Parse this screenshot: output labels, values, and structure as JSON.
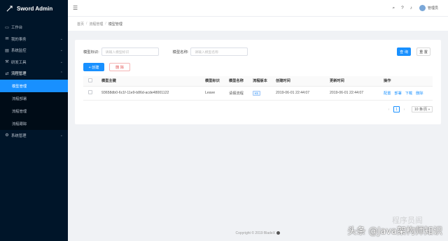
{
  "app": {
    "title": "Sword Admin"
  },
  "sidebar": {
    "items": [
      {
        "icon": "desktop-icon",
        "label": "工作台"
      },
      {
        "icon": "mail-icon",
        "label": "我的事务"
      },
      {
        "icon": "monitor-icon",
        "label": "系统监控"
      },
      {
        "icon": "tool-icon",
        "label": "研发工具"
      },
      {
        "icon": "flow-icon",
        "label": "流程管理"
      },
      {
        "icon": "gear-icon",
        "label": "系统管理"
      }
    ],
    "sub_items": [
      {
        "label": "模型管理"
      },
      {
        "label": "流程部署"
      },
      {
        "label": "流程管理"
      },
      {
        "label": "流程跟踪"
      }
    ]
  },
  "topbar": {
    "username": "管理员"
  },
  "breadcrumb": {
    "items": [
      "首页",
      "流程管理",
      "模型管理"
    ]
  },
  "search": {
    "model_key_label": "模型标识:",
    "model_key_placeholder": "请输入模型标识",
    "model_name_label": "模型名称:",
    "model_name_placeholder": "请输入模型名称",
    "query_label": "查 询",
    "reset_label": "重 置"
  },
  "toolbar": {
    "create_label": "+ 创建",
    "delete_label": "删 除"
  },
  "table": {
    "headers": [
      "模型主键",
      "模型标识",
      "模型名称",
      "流程版本",
      "创建时间",
      "更新时间",
      "操作"
    ],
    "rows": [
      {
        "id": "93658db0-6c1f-11e9-b86d-acde48001122",
        "key": "Leave",
        "name": "请假流程",
        "version": "v1",
        "created": "2019-06-01 22:44:07",
        "updated": "2019-06-01 22:44:07",
        "actions": [
          "配置",
          "部署",
          "下载",
          "删除"
        ]
      }
    ]
  },
  "pagination": {
    "current": "1",
    "page_size": "10 条/页",
    "prev": "‹",
    "next": "›"
  },
  "footer": {
    "text": "Copyright © 2019 BladeX"
  },
  "watermark": {
    "text": "头条 @Java架构师知识",
    "ghost": "程序员阁"
  },
  "colors": {
    "sidebar_bg": "#001529",
    "primary": "#1890ff",
    "danger": "#e05050"
  }
}
